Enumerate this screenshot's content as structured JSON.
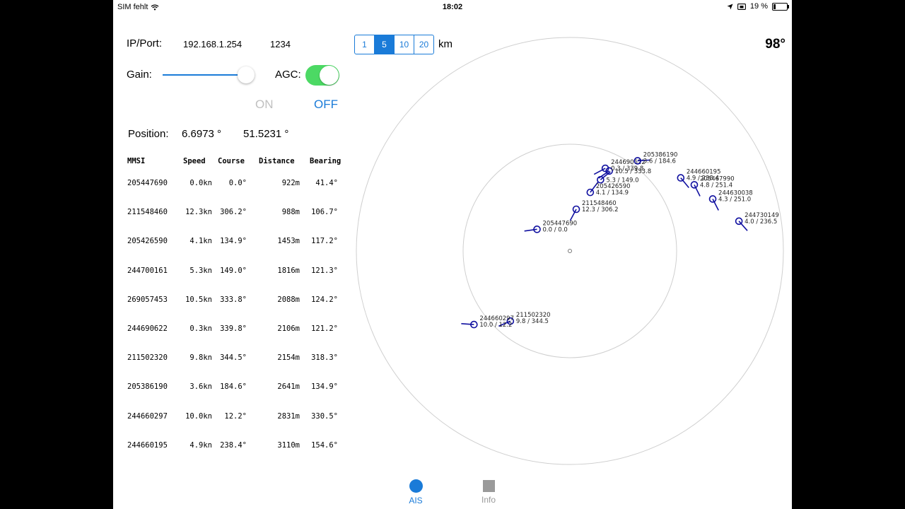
{
  "status": {
    "carrier": "SIM fehlt",
    "time": "18:02",
    "battery": "19 %"
  },
  "connection": {
    "ip_label": "IP/Port:",
    "ip": "192.168.1.254",
    "port": "1234"
  },
  "controls": {
    "gain_label": "Gain:",
    "gain_level": 0.85,
    "agc_label": "AGC:",
    "agc_on": true,
    "on_label": "ON",
    "off_label": "OFF"
  },
  "position": {
    "label": "Position:",
    "lon": "6.6973 °",
    "lat": "51.5231 °"
  },
  "table": {
    "headers": {
      "mmsi": "MMSI",
      "speed": "Speed",
      "course": "Course",
      "distance": "Distance",
      "bearing": "Bearing"
    },
    "rows": [
      {
        "mmsi": "205447690",
        "speed": "0.0kn",
        "course": "0.0°",
        "distance": "922m",
        "bearing": "41.4°"
      },
      {
        "mmsi": "211548460",
        "speed": "12.3kn",
        "course": "306.2°",
        "distance": "988m",
        "bearing": "106.7°"
      },
      {
        "mmsi": "205426590",
        "speed": "4.1kn",
        "course": "134.9°",
        "distance": "1453m",
        "bearing": "117.2°"
      },
      {
        "mmsi": "244700161",
        "speed": "5.3kn",
        "course": "149.0°",
        "distance": "1816m",
        "bearing": "121.3°"
      },
      {
        "mmsi": "269057453",
        "speed": "10.5kn",
        "course": "333.8°",
        "distance": "2088m",
        "bearing": "124.2°"
      },
      {
        "mmsi": "244690622",
        "speed": "0.3kn",
        "course": "339.8°",
        "distance": "2106m",
        "bearing": "121.2°"
      },
      {
        "mmsi": "211502320",
        "speed": "9.8kn",
        "course": "344.5°",
        "distance": "2154m",
        "bearing": "318.3°"
      },
      {
        "mmsi": "205386190",
        "speed": "3.6kn",
        "course": "184.6°",
        "distance": "2641m",
        "bearing": "134.9°"
      },
      {
        "mmsi": "244660297",
        "speed": "10.0kn",
        "course": "12.2°",
        "distance": "2831m",
        "bearing": "330.5°"
      },
      {
        "mmsi": "244660195",
        "speed": "4.9kn",
        "course": "238.4°",
        "distance": "3110m",
        "bearing": "154.6°"
      }
    ]
  },
  "scale": {
    "options": [
      "1",
      "5",
      "10",
      "20"
    ],
    "selected": "5",
    "unit": "km"
  },
  "heading": "98°",
  "radar": {
    "range_km": 5,
    "heading_deg": 98,
    "targets": [
      {
        "id": "205447690",
        "label1": "205447690",
        "label2": "0.0 / 0.0",
        "dist_m": 922,
        "bearing_deg": 41.4,
        "course_deg": 0.0
      },
      {
        "id": "211548460",
        "label1": "211548460",
        "label2": "12.3 / 306.2",
        "dist_m": 988,
        "bearing_deg": 106.7,
        "course_deg": 306.2
      },
      {
        "id": "205426590",
        "label1": "205426590",
        "label2": "4.1 / 134.9",
        "dist_m": 1453,
        "bearing_deg": 117.2,
        "course_deg": 134.9
      },
      {
        "id": "244700161",
        "label1": "",
        "label2": "5.3 / 149.0",
        "dist_m": 1816,
        "bearing_deg": 121.3,
        "course_deg": 149.0
      },
      {
        "id": "269057453",
        "label1": "",
        "label2": "10.5 / 333.8",
        "dist_m": 2088,
        "bearing_deg": 124.2,
        "course_deg": 333.8
      },
      {
        "id": "244690622",
        "label1": "244690622",
        "label2": "0.3 / 339.8",
        "dist_m": 2106,
        "bearing_deg": 121.2,
        "course_deg": 339.8
      },
      {
        "id": "211502320",
        "label1": "211502320",
        "label2": "9.8 / 344.5",
        "dist_m": 2154,
        "bearing_deg": 318.3,
        "course_deg": 344.5
      },
      {
        "id": "205386190",
        "label1": "205386190",
        "label2": "3.6 / 184.6",
        "dist_m": 2641,
        "bearing_deg": 134.9,
        "course_deg": 184.6
      },
      {
        "id": "244660297",
        "label1": "244660297",
        "label2": "10.0 / 12.2",
        "dist_m": 2831,
        "bearing_deg": 330.5,
        "course_deg": 12.2
      },
      {
        "id": "244660195",
        "label1": "244660195",
        "label2": "4.9 / 238.4",
        "dist_m": 3110,
        "bearing_deg": 154.6,
        "course_deg": 238.4
      },
      {
        "id": "205467990",
        "label1": "205467990",
        "label2": "4.8 / 251.4",
        "dist_m": 3300,
        "bearing_deg": 160.0,
        "course_deg": 251.4
      },
      {
        "id": "244630038",
        "label1": "244630038",
        "label2": "4.3 / 251.0",
        "dist_m": 3560,
        "bearing_deg": 168.0,
        "course_deg": 251.0
      },
      {
        "id": "244730149",
        "label1": "244730149",
        "label2": "4.0 / 236.5",
        "dist_m": 4020,
        "bearing_deg": 178.0,
        "course_deg": 236.5
      }
    ]
  },
  "tabs": [
    {
      "label": "AIS",
      "active": true
    },
    {
      "label": "Info",
      "active": false
    }
  ]
}
